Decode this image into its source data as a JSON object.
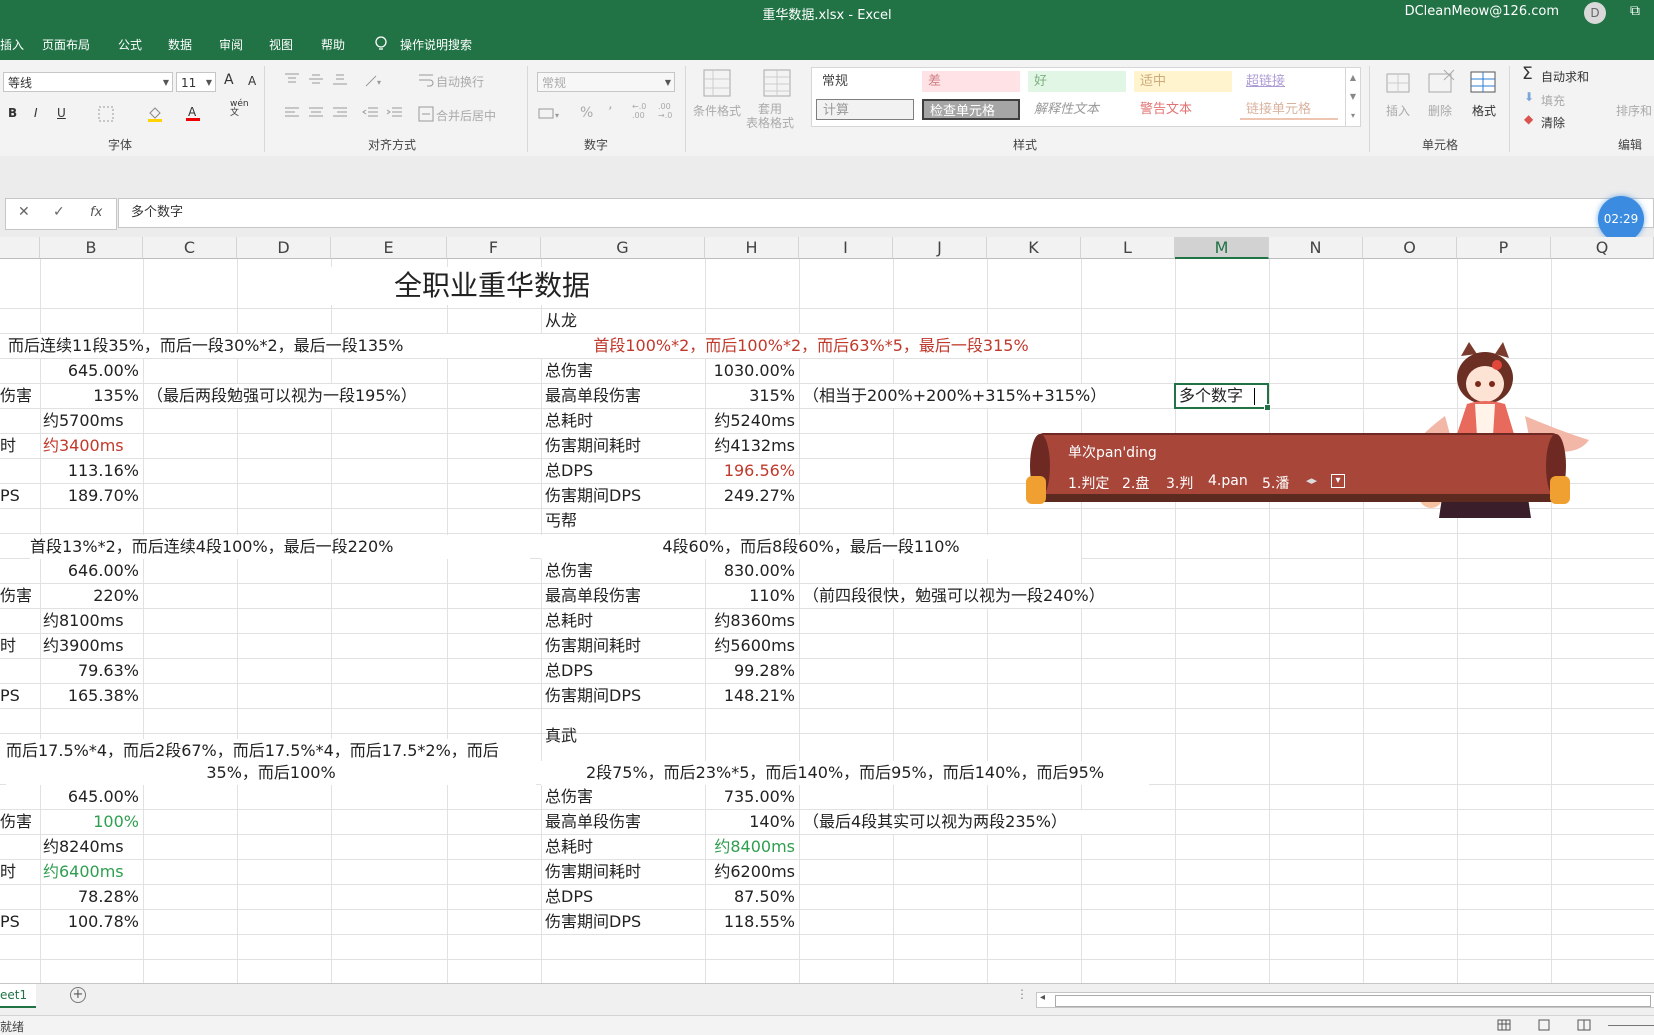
{
  "window": {
    "title": "重华数据.xlsx  -  Excel",
    "user": "DCleanMeow@126.com",
    "avatar": "D",
    "restore_glyph": "⧉"
  },
  "menu": {
    "tabs": [
      "插入",
      "页面布局",
      "公式",
      "数据",
      "审阅",
      "视图",
      "帮助"
    ],
    "search_label": "操作说明搜索"
  },
  "ribbon": {
    "font": {
      "name": "等线",
      "size": "11",
      "grow": "A",
      "shrink": "A",
      "bold": "B",
      "italic": "I",
      "underline": "U",
      "label": "字体",
      "phonetic": "wén\n文"
    },
    "align": {
      "wrap": "自动换行",
      "merge": "合并后居中",
      "label": "对齐方式"
    },
    "number": {
      "format": "常规",
      "percent": "%",
      "comma": "’",
      "inc": "←.0\n.00",
      "dec": ".00\n→.0",
      "label": "数字"
    },
    "styles": {
      "cond_format": "条件格式",
      "table_format": "套用\n表格格式",
      "cells": [
        "常规",
        "差",
        "好",
        "适中",
        "超链接",
        "计算",
        "检查单元格",
        "解释性文本",
        "警告文本",
        "链接单元格"
      ],
      "label": "样式"
    },
    "cells_group": {
      "insert": "插入",
      "delete": "删除",
      "format": "格式",
      "label": "单元格"
    },
    "edit_group": {
      "autosum": "自动求和",
      "fill": "填充",
      "clear": "清除",
      "sort": "排序和",
      "label": "编辑"
    }
  },
  "formula_bar": {
    "cancel": "✕",
    "enter": "✓",
    "fx": "fx",
    "content": "多个数字"
  },
  "timer": "02:29",
  "columns": [
    "B",
    "C",
    "D",
    "E",
    "F",
    "G",
    "H",
    "I",
    "J",
    "K",
    "L",
    "M",
    "N",
    "O",
    "P",
    "Q"
  ],
  "sheet": {
    "title": "全职业重华数据",
    "left": {
      "block1": {
        "desc": "而后连续11段35%，而后一段30%*2，最后一段135%",
        "labels": [
          "伤害",
          "时",
          "PS"
        ],
        "values": [
          "645.00%",
          "135%",
          "约5700ms",
          "约3400ms",
          "113.16%",
          "189.70%"
        ],
        "note": "（最后两段勉强可以视为一段195%）"
      },
      "block2": {
        "desc": "首段13%*2，而后连续4段100%，最后一段220%",
        "labels": [
          "伤害",
          "时",
          "PS"
        ],
        "values": [
          "646.00%",
          "220%",
          "约8100ms",
          "约3900ms",
          "79.63%",
          "165.38%"
        ]
      },
      "block3": {
        "desc1": "而后17.5%*4，而后2段67%，而后17.5%*4，而后17.5*2%，而后",
        "desc2": "35%，而后100%",
        "labels": [
          "伤害",
          "时",
          "PS"
        ],
        "values": [
          "645.00%",
          "100%",
          "约8240ms",
          "约6400ms",
          "78.28%",
          "100.78%"
        ]
      }
    },
    "right": {
      "block1": {
        "name": "从龙",
        "desc": "首段100%*2，而后100%*2，而后63%*5，最后一段315%",
        "labels": [
          "总伤害",
          "最高单段伤害",
          "总耗时",
          "伤害期间耗时",
          "总DPS",
          "伤害期间DPS"
        ],
        "values": [
          "1030.00%",
          "315%",
          "约5240ms",
          "约4132ms",
          "196.56%",
          "249.27%"
        ],
        "note": "（相当于200%+200%+315%+315%）"
      },
      "block2": {
        "name": "丐帮",
        "desc": "4段60%，而后8段60%，最后一段110%",
        "labels": [
          "总伤害",
          "最高单段伤害",
          "总耗时",
          "伤害期间耗时",
          "总DPS",
          "伤害期间DPS"
        ],
        "values": [
          "830.00%",
          "110%",
          "约8360ms",
          "约5600ms",
          "99.28%",
          "148.21%"
        ],
        "note": "（前四段很快，勉强可以视为一段240%）"
      },
      "block3": {
        "name": "真武",
        "desc": "2段75%，而后23%*5，而后140%，而后95%，而后140%，而后95%",
        "labels": [
          "总伤害",
          "最高单段伤害",
          "总耗时",
          "伤害期间耗时",
          "总DPS",
          "伤害期间DPS"
        ],
        "values": [
          "735.00%",
          "140%",
          "约8400ms",
          "约6200ms",
          "87.50%",
          "118.55%"
        ],
        "note": "（最后4段其实可以视为两段235%）"
      }
    },
    "active_cell": "多个数字"
  },
  "ime": {
    "composition": "单次pan'ding",
    "candidates": [
      "1.判定",
      "2.盘",
      "3.判",
      "4.pan",
      "5.潘"
    ]
  },
  "sheet_tabs": {
    "active": "eet1",
    "add": "+"
  },
  "status": {
    "mode": "就绪"
  }
}
